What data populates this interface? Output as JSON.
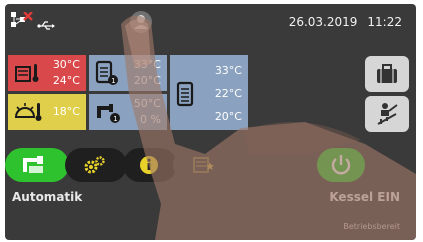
{
  "status": {
    "date": "26.03.2019",
    "time": "11:22",
    "icons": [
      "network-error-icon",
      "usb-icon",
      "user-icon"
    ]
  },
  "tiles": {
    "solar": {
      "icon": "solar-thermometer-icon",
      "values": [
        "30°C",
        "24°C"
      ],
      "color": "#d9494b"
    },
    "buffer_small": {
      "icon": "buffer-tank-icon",
      "values": [
        "33°C",
        "20°C"
      ],
      "color": "#8aa2bf"
    },
    "buffer_large": {
      "icon": "buffer-storage-icon",
      "values": [
        "33°C",
        "22°C",
        "20°C"
      ],
      "color": "#8aa2bf"
    },
    "outdoor": {
      "icon": "outdoor-sun-thermometer-icon",
      "values": [
        "18°C"
      ],
      "color": "#e0cf4a"
    },
    "hot_water": {
      "icon": "hot-water-tap-icon",
      "values": [
        "50°C",
        "0 %"
      ],
      "color": "#8aa2bf"
    }
  },
  "side_buttons": [
    "suitcase-icon",
    "chimney-sweep-icon"
  ],
  "nav": {
    "items": [
      "automatic-mode-icon",
      "settings-gears-icon",
      "info-icon",
      "book-star-icon",
      "power-icon"
    ],
    "automatic_label": "Automatik",
    "boiler_label": "Kessel EIN",
    "boiler_status": "Betriebsbereit",
    "accent_green": "#2fc22f",
    "pill_dark": "#1f1f1f"
  }
}
